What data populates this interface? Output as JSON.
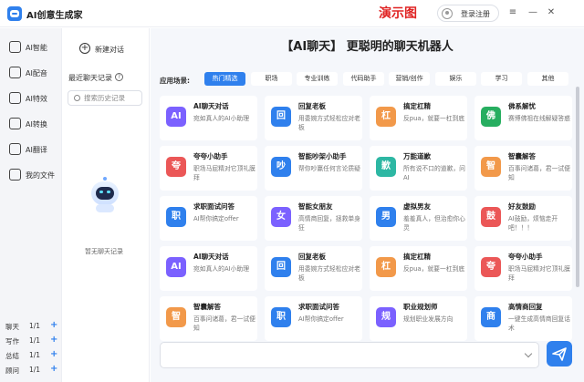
{
  "titlebar": {
    "app_title": "AI创意生成家",
    "demo_label": "演示图",
    "login_label": "登录注册",
    "controls": {
      "menu": "≡",
      "minimize": "—",
      "close": "✕"
    }
  },
  "nav": {
    "items": [
      {
        "label": "AI智能",
        "icon": "robot-icon"
      },
      {
        "label": "AI配音",
        "icon": "audio-icon"
      },
      {
        "label": "AI特效",
        "icon": "effect-icon"
      },
      {
        "label": "AI转换",
        "icon": "convert-icon"
      },
      {
        "label": "AI翻译",
        "icon": "translate-icon"
      },
      {
        "label": "我的文件",
        "icon": "folder-icon"
      }
    ],
    "quotas": [
      {
        "name": "聊天",
        "value": "1/1",
        "plus": "+"
      },
      {
        "name": "写作",
        "value": "1/1",
        "plus": "+"
      },
      {
        "name": "总结",
        "value": "1/1",
        "plus": "+"
      },
      {
        "name": "顾问",
        "value": "1/1",
        "plus": "+"
      }
    ]
  },
  "history": {
    "new_chat": "新建对话",
    "recent_title": "最近聊天记录",
    "help": "?",
    "search_placeholder": "搜索历史记录",
    "empty_text": "暂无聊天记录"
  },
  "main": {
    "title": "【AI聊天】 更聪明的聊天机器人",
    "scene_label": "应用场景:",
    "tabs": [
      "热门精选",
      "职场",
      "专业训练",
      "代码助手",
      "营销/创作",
      "娱乐",
      "学习",
      "其他"
    ],
    "active_tab": 0,
    "cards": [
      {
        "title": "AI聊天对话",
        "desc": "宛如真人的AI小助理",
        "color": "#7b61ff",
        "glyph": "AI"
      },
      {
        "title": "回复老板",
        "desc": "用委婉方式轻松应对老板",
        "color": "#2f80ed",
        "glyph": "回"
      },
      {
        "title": "搞定杠精",
        "desc": "反pua，就要一杠到底",
        "color": "#f2994a",
        "glyph": "杠"
      },
      {
        "title": "佛系解忧",
        "desc": "赛博佛祖在线解疑答惑",
        "color": "#27ae60",
        "glyph": "佛"
      },
      {
        "title": "夸夸小助手",
        "desc": "职场马屁精对它顶礼膜拜",
        "color": "#eb5757",
        "glyph": "夸"
      },
      {
        "title": "智能吵架小助手",
        "desc": "帮你吵赢任何言论质疑",
        "color": "#2f80ed",
        "glyph": "吵"
      },
      {
        "title": "万能道歉",
        "desc": "所有说不口的道歉，问AI",
        "color": "#2db7a3",
        "glyph": "歉"
      },
      {
        "title": "智囊解答",
        "desc": "百事问诸葛，君一试便知",
        "color": "#f2994a",
        "glyph": "智"
      },
      {
        "title": "求职面试问答",
        "desc": "AI帮你搞定offer",
        "color": "#2f80ed",
        "glyph": "职"
      },
      {
        "title": "智能女朋友",
        "desc": "高情商回复，拯救单身狂",
        "color": "#7b61ff",
        "glyph": "女"
      },
      {
        "title": "虚拟男友",
        "desc": "羞羞真人，但治愈你心灵",
        "color": "#2f80ed",
        "glyph": "男"
      },
      {
        "title": "好友鼓励",
        "desc": "AI鼓励，烦恼走开吧！！！",
        "color": "#eb5757",
        "glyph": "鼓"
      },
      {
        "title": "AI聊天对话",
        "desc": "宛如真人的AI小助理",
        "color": "#7b61ff",
        "glyph": "AI"
      },
      {
        "title": "回复老板",
        "desc": "用委婉方式轻松应对老板",
        "color": "#2f80ed",
        "glyph": "回"
      },
      {
        "title": "搞定杠精",
        "desc": "反pua，就要一杠到底",
        "color": "#f2994a",
        "glyph": "杠"
      },
      {
        "title": "夸夸小助手",
        "desc": "职场马屁精对它顶礼膜拜",
        "color": "#eb5757",
        "glyph": "夸"
      },
      {
        "title": "智囊解答",
        "desc": "百事问诸葛，君一试便知",
        "color": "#f2994a",
        "glyph": "智"
      },
      {
        "title": "求职面试问答",
        "desc": "AI帮你搞定offer",
        "color": "#2f80ed",
        "glyph": "职"
      },
      {
        "title": "职业规划师",
        "desc": "规划职业发展方向",
        "color": "#7b61ff",
        "glyph": "规"
      },
      {
        "title": "高情商回复",
        "desc": "一键生成高情商回复话术",
        "color": "#2f80ed",
        "glyph": "商"
      }
    ]
  },
  "input": {
    "placeholder": ""
  },
  "colors": {
    "accent": "#2f80ed",
    "demo_red": "#e02424"
  }
}
